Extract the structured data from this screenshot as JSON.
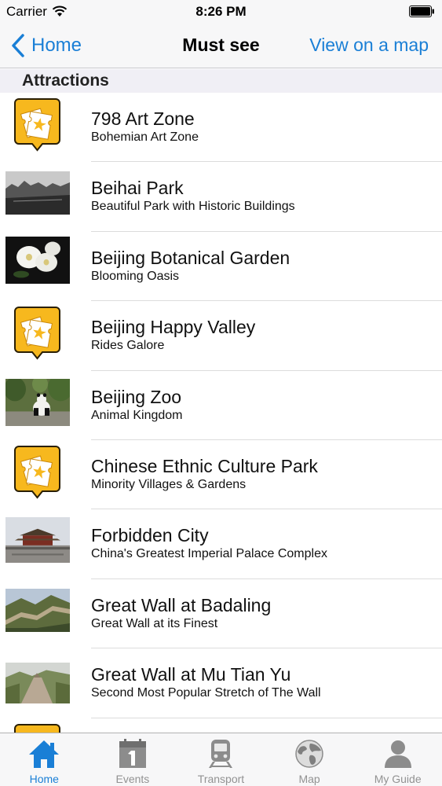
{
  "status_bar": {
    "carrier": "Carrier",
    "time": "8:26 PM"
  },
  "nav": {
    "back_label": "Home",
    "title": "Must see",
    "right_label": "View on a map"
  },
  "section": {
    "title": "Attractions"
  },
  "colors": {
    "accent": "#1a7fd6",
    "badge": "#f7b81e",
    "tab_inactive": "#929292"
  },
  "rows": [
    {
      "title": "798 Art Zone",
      "subtitle": "Bohemian Art Zone",
      "thumb": "ticket-badge-icon"
    },
    {
      "title": "Beihai Park",
      "subtitle": "Beautiful Park with Historic Buildings",
      "thumb": "beihai-park-photo"
    },
    {
      "title": "Beijing Botanical Garden",
      "subtitle": "Blooming Oasis",
      "thumb": "botanical-garden-photo"
    },
    {
      "title": "Beijing Happy Valley",
      "subtitle": "Rides Galore",
      "thumb": "ticket-badge-icon"
    },
    {
      "title": "Beijing Zoo",
      "subtitle": "Animal Kingdom",
      "thumb": "beijing-zoo-photo"
    },
    {
      "title": "Chinese Ethnic Culture Park",
      "subtitle": "Minority Villages & Gardens",
      "thumb": "ticket-badge-icon"
    },
    {
      "title": "Forbidden City",
      "subtitle": "China's Greatest Imperial Palace Complex",
      "thumb": "forbidden-city-photo"
    },
    {
      "title": "Great Wall at Badaling",
      "subtitle": "Great Wall at its Finest",
      "thumb": "badaling-photo"
    },
    {
      "title": "Great Wall at Mu Tian Yu",
      "subtitle": "Second Most Popular Stretch of The Wall",
      "thumb": "mutianyu-photo"
    },
    {
      "title": "",
      "subtitle": "",
      "thumb": "ticket-badge-icon"
    }
  ],
  "tabs": [
    {
      "label": "Home",
      "icon": "home-icon",
      "active": true
    },
    {
      "label": "Events",
      "icon": "calendar-icon",
      "active": false
    },
    {
      "label": "Transport",
      "icon": "train-icon",
      "active": false
    },
    {
      "label": "Map",
      "icon": "globe-icon",
      "active": false
    },
    {
      "label": "My Guide",
      "icon": "person-icon",
      "active": false
    }
  ]
}
